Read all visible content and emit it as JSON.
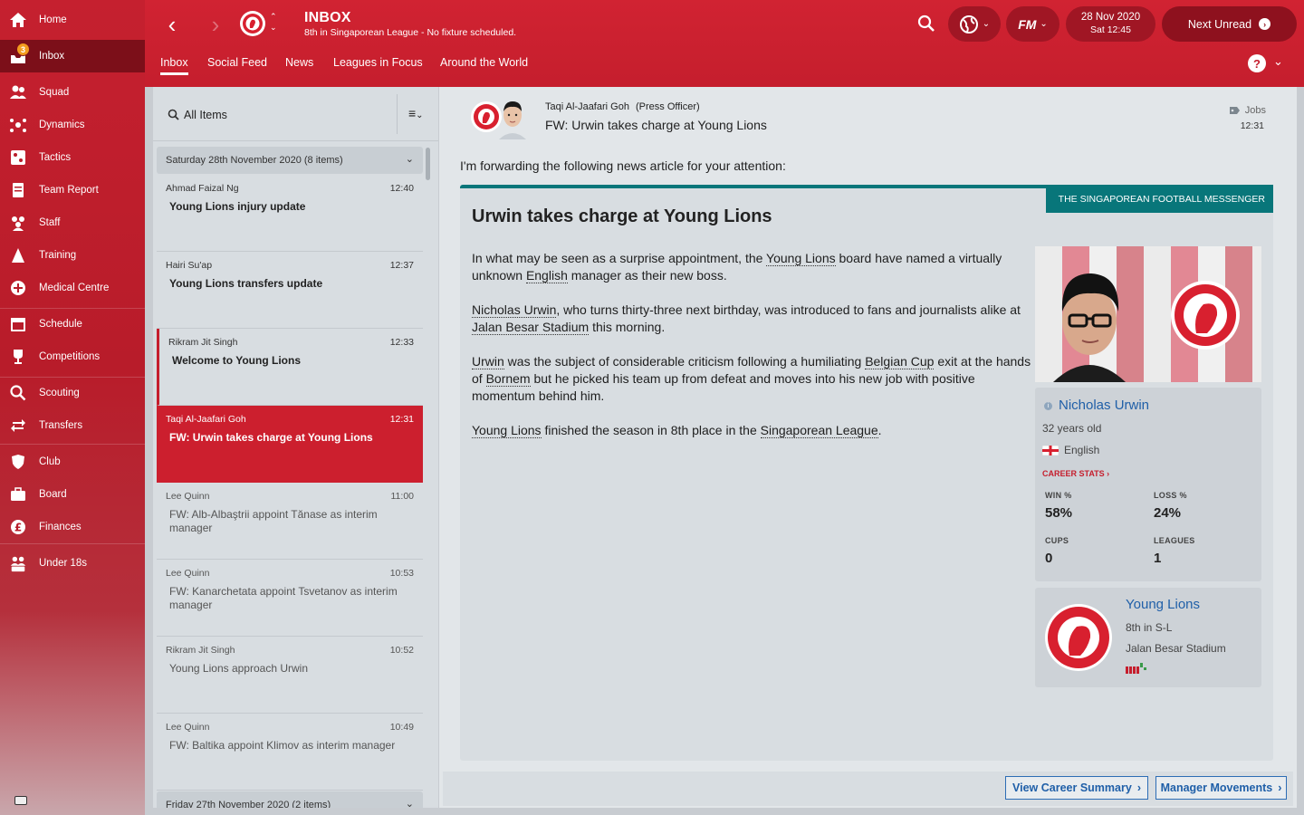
{
  "sidebar": {
    "items": [
      {
        "label": "Home",
        "icon": "home-icon"
      },
      {
        "label": "Inbox",
        "icon": "inbox-icon",
        "badge": "3"
      },
      {
        "label": "Squad",
        "icon": "squad-icon"
      },
      {
        "label": "Dynamics",
        "icon": "dynamics-icon"
      },
      {
        "label": "Tactics",
        "icon": "tactics-icon"
      },
      {
        "label": "Team Report",
        "icon": "team-report-icon"
      },
      {
        "label": "Staff",
        "icon": "staff-icon"
      },
      {
        "label": "Training",
        "icon": "training-icon"
      },
      {
        "label": "Medical Centre",
        "icon": "medical-icon"
      },
      {
        "label": "Schedule",
        "icon": "schedule-icon"
      },
      {
        "label": "Competitions",
        "icon": "trophy-icon"
      },
      {
        "label": "Scouting",
        "icon": "search-icon"
      },
      {
        "label": "Transfers",
        "icon": "transfers-icon"
      },
      {
        "label": "Club",
        "icon": "club-shield-icon"
      },
      {
        "label": "Board",
        "icon": "briefcase-icon"
      },
      {
        "label": "Finances",
        "icon": "pound-icon"
      },
      {
        "label": "Under 18s",
        "icon": "u18-icon"
      }
    ]
  },
  "header": {
    "title": "INBOX",
    "subtitle": "8th in Singaporean League - No fixture scheduled.",
    "tabs": [
      "Inbox",
      "Social Feed",
      "News",
      "Leagues in Focus",
      "Around the World"
    ],
    "fm_label": "FM",
    "date": "28 Nov 2020",
    "time": "Sat 12:45",
    "next_unread": "Next Unread",
    "help": "?"
  },
  "list": {
    "filter_label": "All Items",
    "group1": "Saturday 28th November 2020 (8 items)",
    "group2": "Friday 27th November 2020 (2 items)",
    "messages": [
      {
        "sender": "Ahmad Faizal Ng",
        "time": "12:40",
        "subject": "Young Lions injury update"
      },
      {
        "sender": "Hairi Su'ap",
        "time": "12:37",
        "subject": "Young Lions transfers update"
      },
      {
        "sender": "Rikram Jit Singh",
        "time": "12:33",
        "subject": "Welcome to Young Lions"
      },
      {
        "sender": "Taqi Al-Jaafari Goh",
        "time": "12:31",
        "subject": "FW: Urwin takes charge at Young Lions"
      },
      {
        "sender": "Lee Quinn",
        "time": "11:00",
        "subject": "FW: Alb-Albaştrii appoint Tănase as interim manager"
      },
      {
        "sender": "Lee Quinn",
        "time": "10:53",
        "subject": "FW: Kanarchetata appoint Tsvetanov as interim manager"
      },
      {
        "sender": "Rikram Jit Singh",
        "time": "10:52",
        "subject": "Young Lions approach Urwin"
      },
      {
        "sender": "Lee Quinn",
        "time": "10:49",
        "subject": "FW: Baltika appoint Klimov as interim manager"
      }
    ]
  },
  "message": {
    "sender_name": "Taqi Al-Jaafari Goh",
    "sender_role": "(Press Officer)",
    "subject": "FW: Urwin takes charge at Young Lions",
    "category": "Jobs",
    "time": "12:31",
    "intro": "I'm forwarding the following news article for your attention:",
    "source": "THE SINGAPOREAN FOOTBALL MESSENGER",
    "headline": "Urwin takes charge at Young Lions",
    "p1": {
      "a": "In what may be seen as a surprise appointment, the ",
      "l1": "Young Lions",
      "b": " board have named a virtually unknown ",
      "l2": "English",
      "c": " manager as their new boss."
    },
    "p2": {
      "l1": "Nicholas Urwin",
      "a": ", who turns thirty-three next birthday, was introduced to fans and journalists alike at ",
      "l2": "Jalan Besar Stadium",
      "b": " this morning."
    },
    "p3": {
      "l1": "Urwin",
      "a": " was the subject of considerable criticism following a humiliating ",
      "l2": "Belgian Cup",
      "b": " exit at the hands of ",
      "l3": "Bornem",
      "c": " but he picked his team up from defeat and moves into his new job with positive momentum behind him."
    },
    "p4": {
      "l1": "Young Lions",
      "a": " finished the season in 8th place in the ",
      "l2": "Singaporean League",
      "b": "."
    }
  },
  "manager_card": {
    "name": "Nicholas Urwin",
    "age": "32 years old",
    "nationality": "English",
    "career_stats": "CAREER STATS",
    "win_label": "WIN %",
    "win": "58%",
    "loss_label": "LOSS %",
    "loss": "24%",
    "cups_label": "CUPS",
    "cups": "0",
    "leagues_label": "LEAGUES",
    "leagues": "1"
  },
  "club_card": {
    "name": "Young Lions",
    "position": "8th in S-L",
    "stadium": "Jalan Besar Stadium",
    "badge_text": "YOUNG LIONS"
  },
  "buttons": {
    "career_summary": "View Career Summary",
    "manager_movements": "Manager Movements"
  },
  "colors": {
    "accent": "#c51e2d",
    "teal": "#08767a",
    "link": "#1f5fa8"
  }
}
